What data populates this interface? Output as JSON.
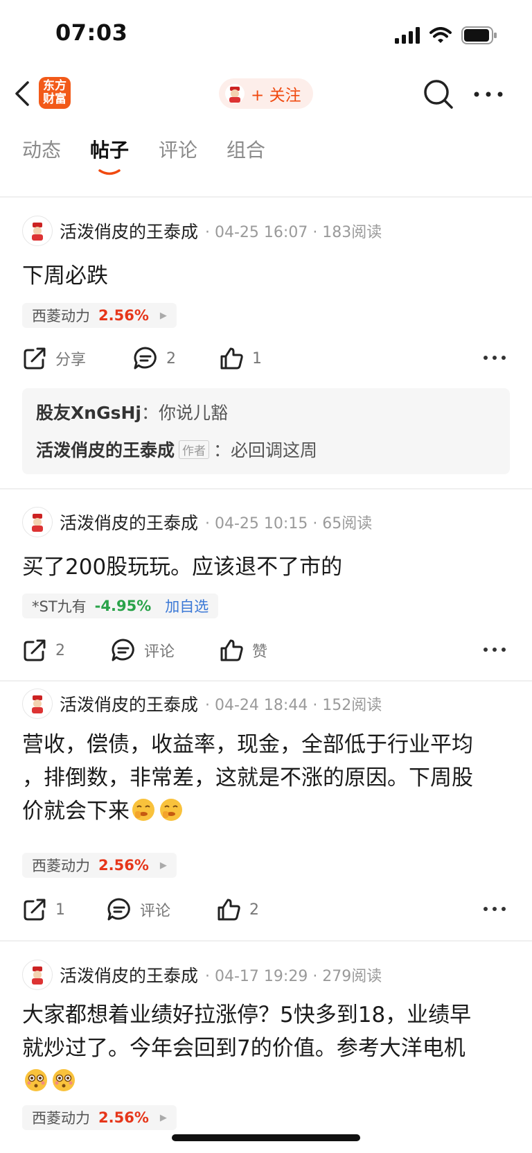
{
  "status_bar": {
    "time": "07:03"
  },
  "header": {
    "logo_text": "东方财富",
    "follow_label": "+ 关注"
  },
  "tabs": [
    {
      "label": "动态"
    },
    {
      "label": "帖子"
    },
    {
      "label": "评论"
    },
    {
      "label": "组合"
    }
  ],
  "colors": {
    "accent": "#f04a10",
    "up": "#e6361a",
    "down": "#2aa34a",
    "link": "#3a78d6"
  },
  "posts": [
    {
      "author": "活泼俏皮的王泰成",
      "meta": "· 04-25 16:07 · 183阅读",
      "text": "下周必跌",
      "stock": {
        "name": "西菱动力",
        "change": "2.56%"
      },
      "actions": {
        "share": "分享",
        "comment": "2",
        "like": "1"
      },
      "comments": [
        {
          "user": "股友XnGsHj",
          "sep": "：",
          "text": "你说儿豁"
        },
        {
          "user": "活泼俏皮的王泰成",
          "badge": "作者",
          "sep": "：",
          "text": "必回调这周"
        }
      ]
    },
    {
      "author": "活泼俏皮的王泰成",
      "meta": "· 04-25 10:15 · 65阅读",
      "text": "买了200股玩玩。应该退不了市的",
      "stock": {
        "name": "*ST九有",
        "change": "-4.95%",
        "add_label": "加自选"
      },
      "actions": {
        "share": "2",
        "comment": "评论",
        "like": "赞"
      }
    },
    {
      "author": "活泼俏皮的王泰成",
      "meta": "· 04-24 18:44 · 152阅读",
      "text_lines": [
        "营收，偿债，收益率，现金，全部低于行业平均",
        "，排倒数，非常差，这就是不涨的原因。下周股",
        "价就会下来"
      ],
      "stock": {
        "name": "西菱动力",
        "change": "2.56%"
      },
      "actions": {
        "share": "1",
        "comment": "评论",
        "like": "2"
      }
    },
    {
      "author": "活泼俏皮的王泰成",
      "meta": "· 04-17 19:29 · 279阅读",
      "text_lines": [
        "大家都想着业绩好拉涨停？5快多到18，业绩早",
        "就炒过了。今年会回到7的价值。参考大洋电机"
      ],
      "stock": {
        "name": "西菱动力",
        "change": "2.56%"
      }
    }
  ]
}
